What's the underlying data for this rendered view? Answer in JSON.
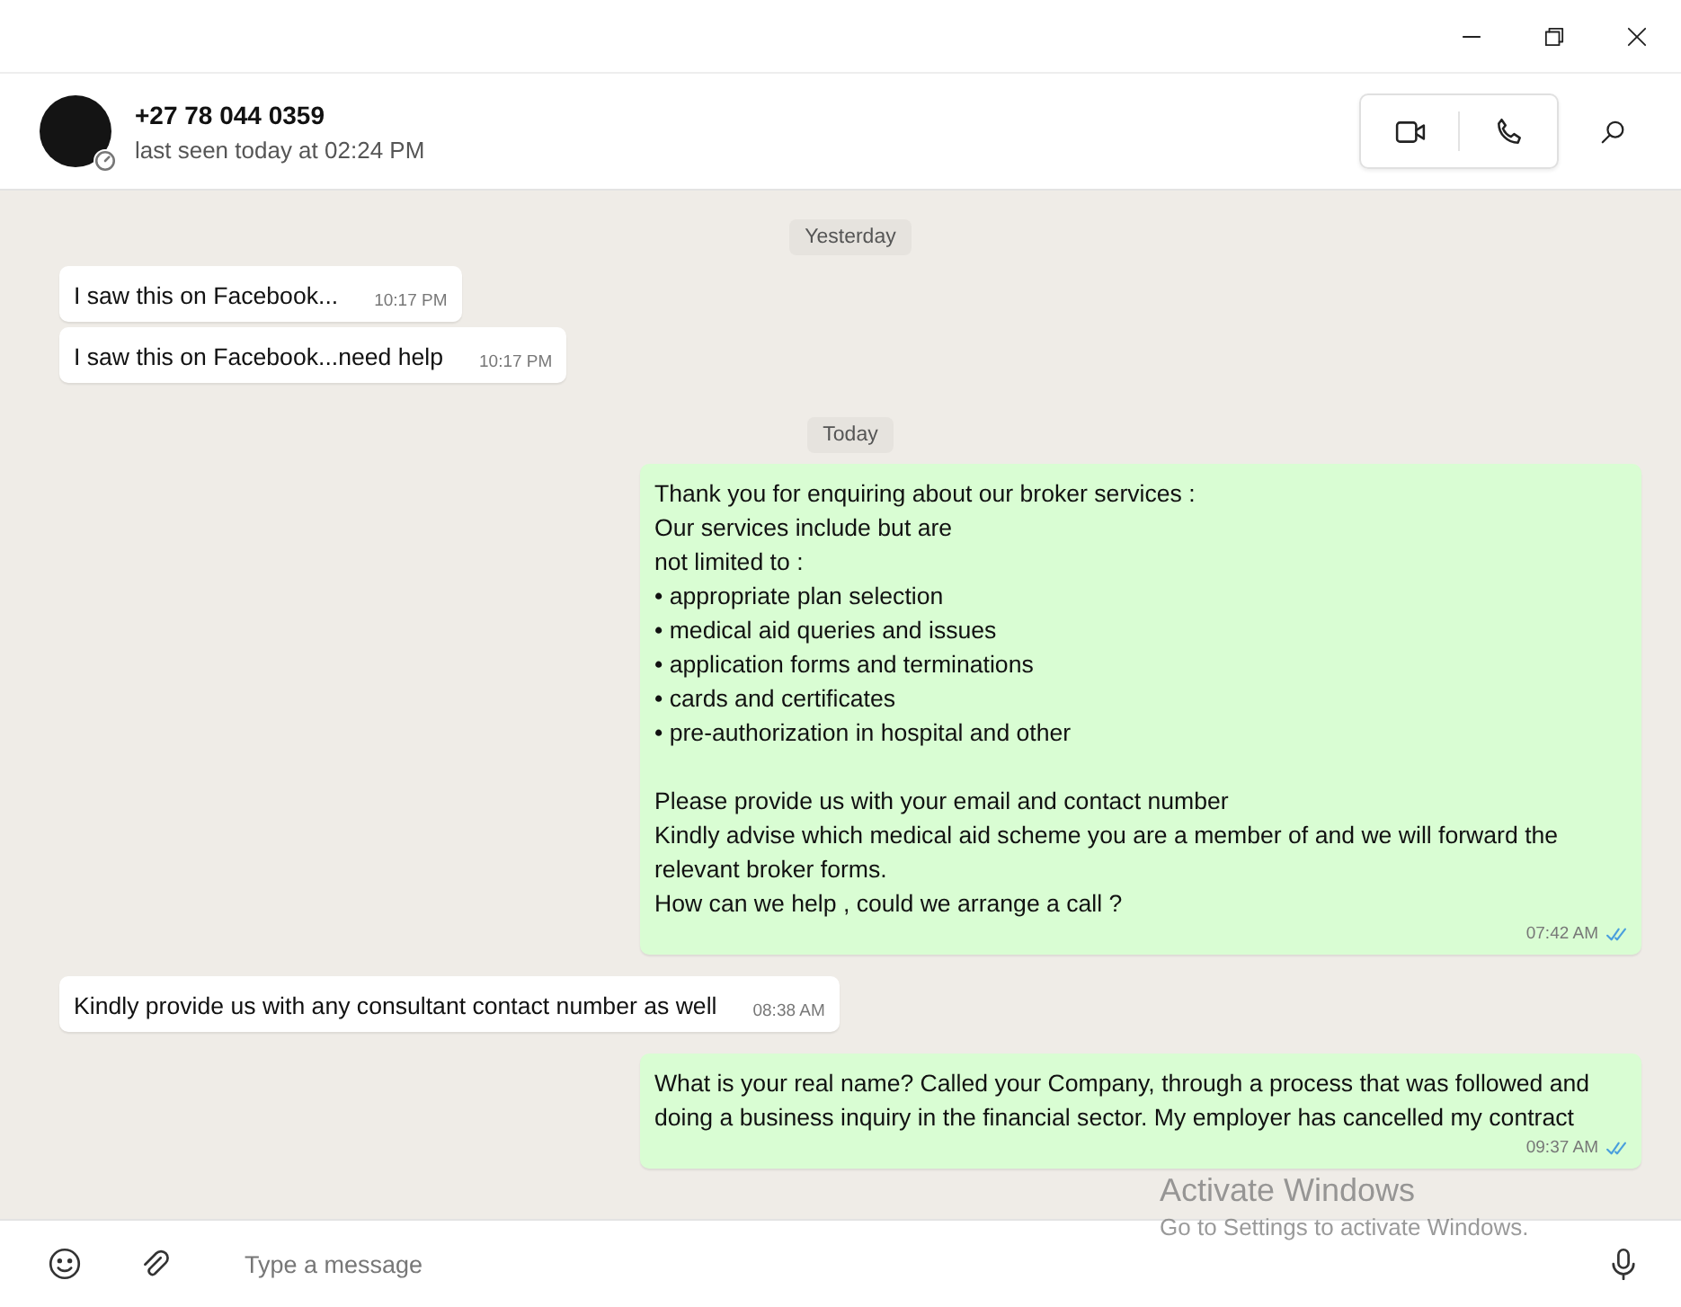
{
  "window": {
    "controls": [
      {
        "kind": "minimize"
      },
      {
        "kind": "restore"
      },
      {
        "kind": "close"
      }
    ]
  },
  "contact": {
    "name": "+27 78 044 0359",
    "status": "last seen today at 02:24 PM",
    "has_status_ring": true
  },
  "header_actions": [
    {
      "kind": "video"
    },
    {
      "kind": "call"
    }
  ],
  "messages": [
    {
      "kind": "date",
      "text": "Yesterday"
    },
    {
      "kind": "in",
      "paragraphs": [
        [
          "I saw this on Facebook..."
        ]
      ],
      "time": "10:17 PM"
    },
    {
      "kind": "in",
      "paragraphs": [
        [
          "I saw this on Facebook...need help"
        ]
      ],
      "time": "10:17 PM"
    },
    {
      "kind": "date",
      "text": "Today"
    },
    {
      "kind": "out",
      "paragraphs": [
        [
          "Thank you for enquiring about our broker services :",
          "Our services include but are",
          "not limited to :",
          "• appropriate plan selection",
          "• medical aid queries and issues",
          "• application forms and terminations",
          "• cards and certificates",
          "• pre-authorization in hospital and other"
        ],
        [
          "Please provide us with your email and contact number",
          "Kindly advise which medical aid scheme you are a member of and we will forward the relevant broker forms.",
          "How can we help , could we arrange a call ?"
        ]
      ],
      "time": "07:42 AM",
      "read": true
    },
    {
      "kind": "in",
      "paragraphs": [
        [
          "Kindly provide us with any consultant contact number as well"
        ]
      ],
      "time": "08:38 AM"
    },
    {
      "kind": "out",
      "paragraphs": [
        [
          "What is your real name? Called your Company, through a process that was followed and doing a business inquiry in the financial sector. My employer has cancelled my contract"
        ]
      ],
      "time": "09:37 AM",
      "read": true
    }
  ],
  "composer": {
    "placeholder": "Type a message"
  },
  "activation_notice": {
    "title": "Activate Windows",
    "subtitle": "Go to Settings to activate Windows."
  }
}
